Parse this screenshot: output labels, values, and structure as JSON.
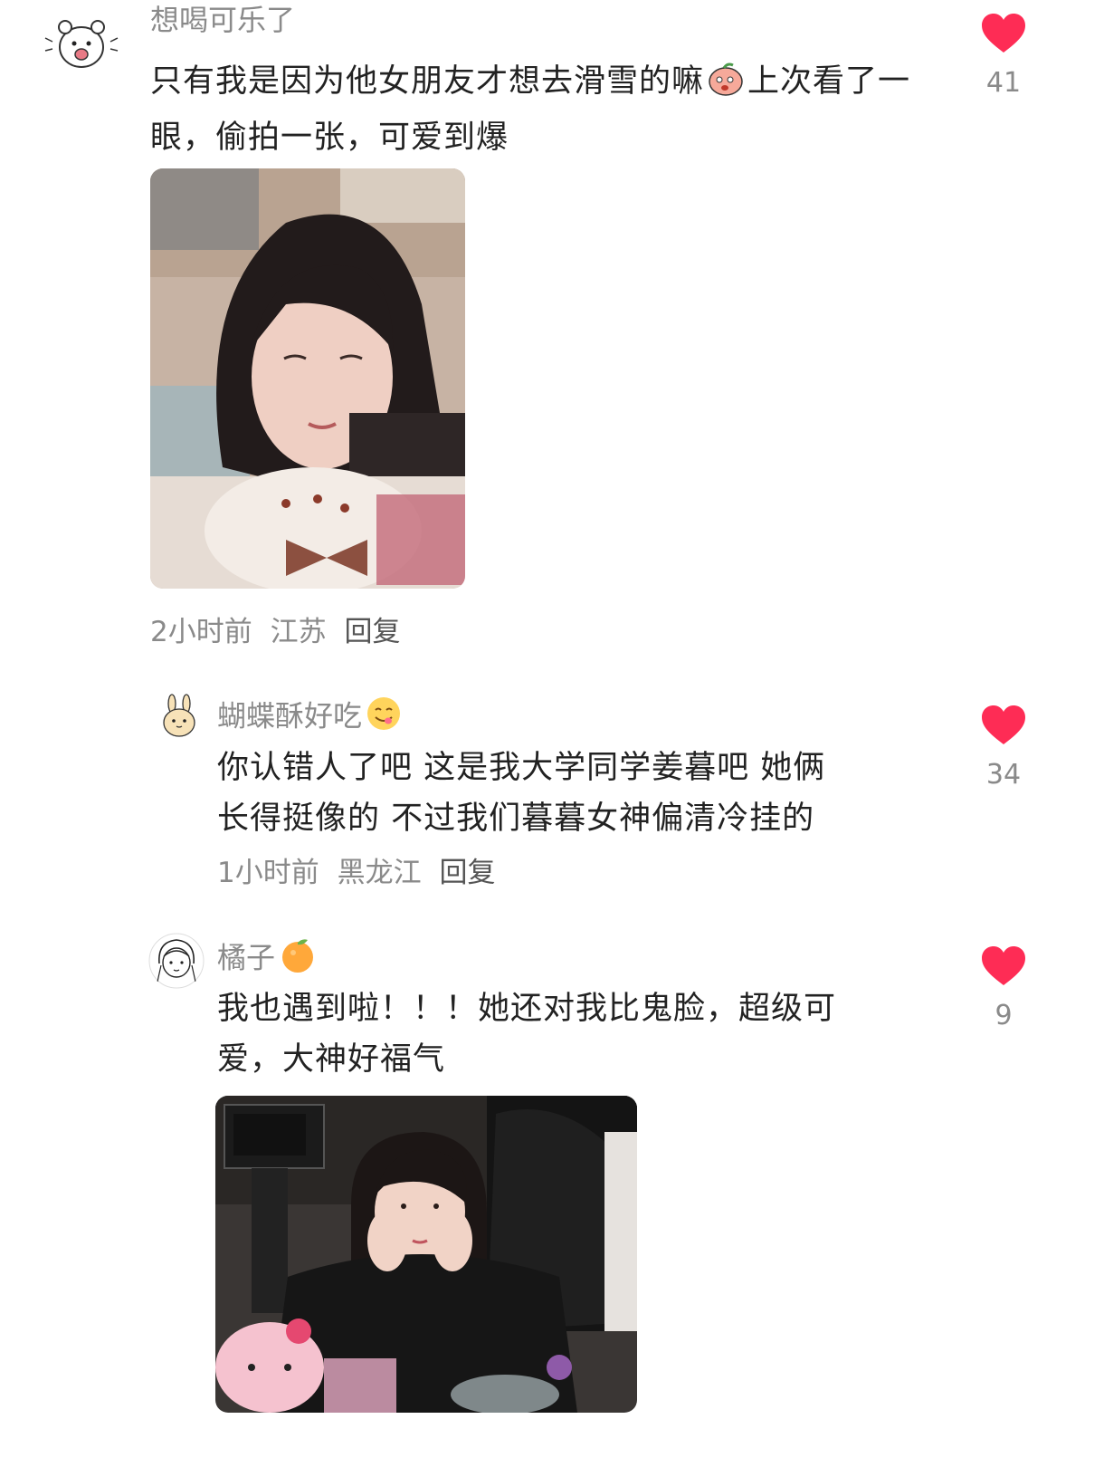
{
  "comments": [
    {
      "username": "想喝可乐了",
      "text_part1": "只有我是因为他女朋友才想去滑雪的嘛",
      "text_part2": "上次看了一眼，偷拍一张，可爱到爆",
      "text_emoji": "peach-face-emoji",
      "time": "2小时前",
      "location": "江苏",
      "reply_label": "回复",
      "likes": "41",
      "avatar_icon": "hamster-avatar"
    },
    {
      "username": "蝴蝶酥好吃",
      "username_emoji": "yum-face-emoji",
      "text_line1": "你认错人了吧 这是我大学同学姜暮吧 她俩",
      "text_line2": "长得挺像的 不过我们暮暮女神偏清冷挂的",
      "time": "1小时前",
      "location": "黑龙江",
      "reply_label": "回复",
      "likes": "34",
      "avatar_icon": "bunny-avatar"
    },
    {
      "username": "橘子",
      "username_emoji": "tangerine-emoji",
      "text_line1": "我也遇到啦！！！她还对我比鬼脸，超级可",
      "text_line2": "爱，大神好福气",
      "likes": "9",
      "avatar_icon": "girl-sketch-avatar"
    }
  ],
  "colors": {
    "like_red": "#fe2c55",
    "meta_gray": "#8a8a8a"
  }
}
